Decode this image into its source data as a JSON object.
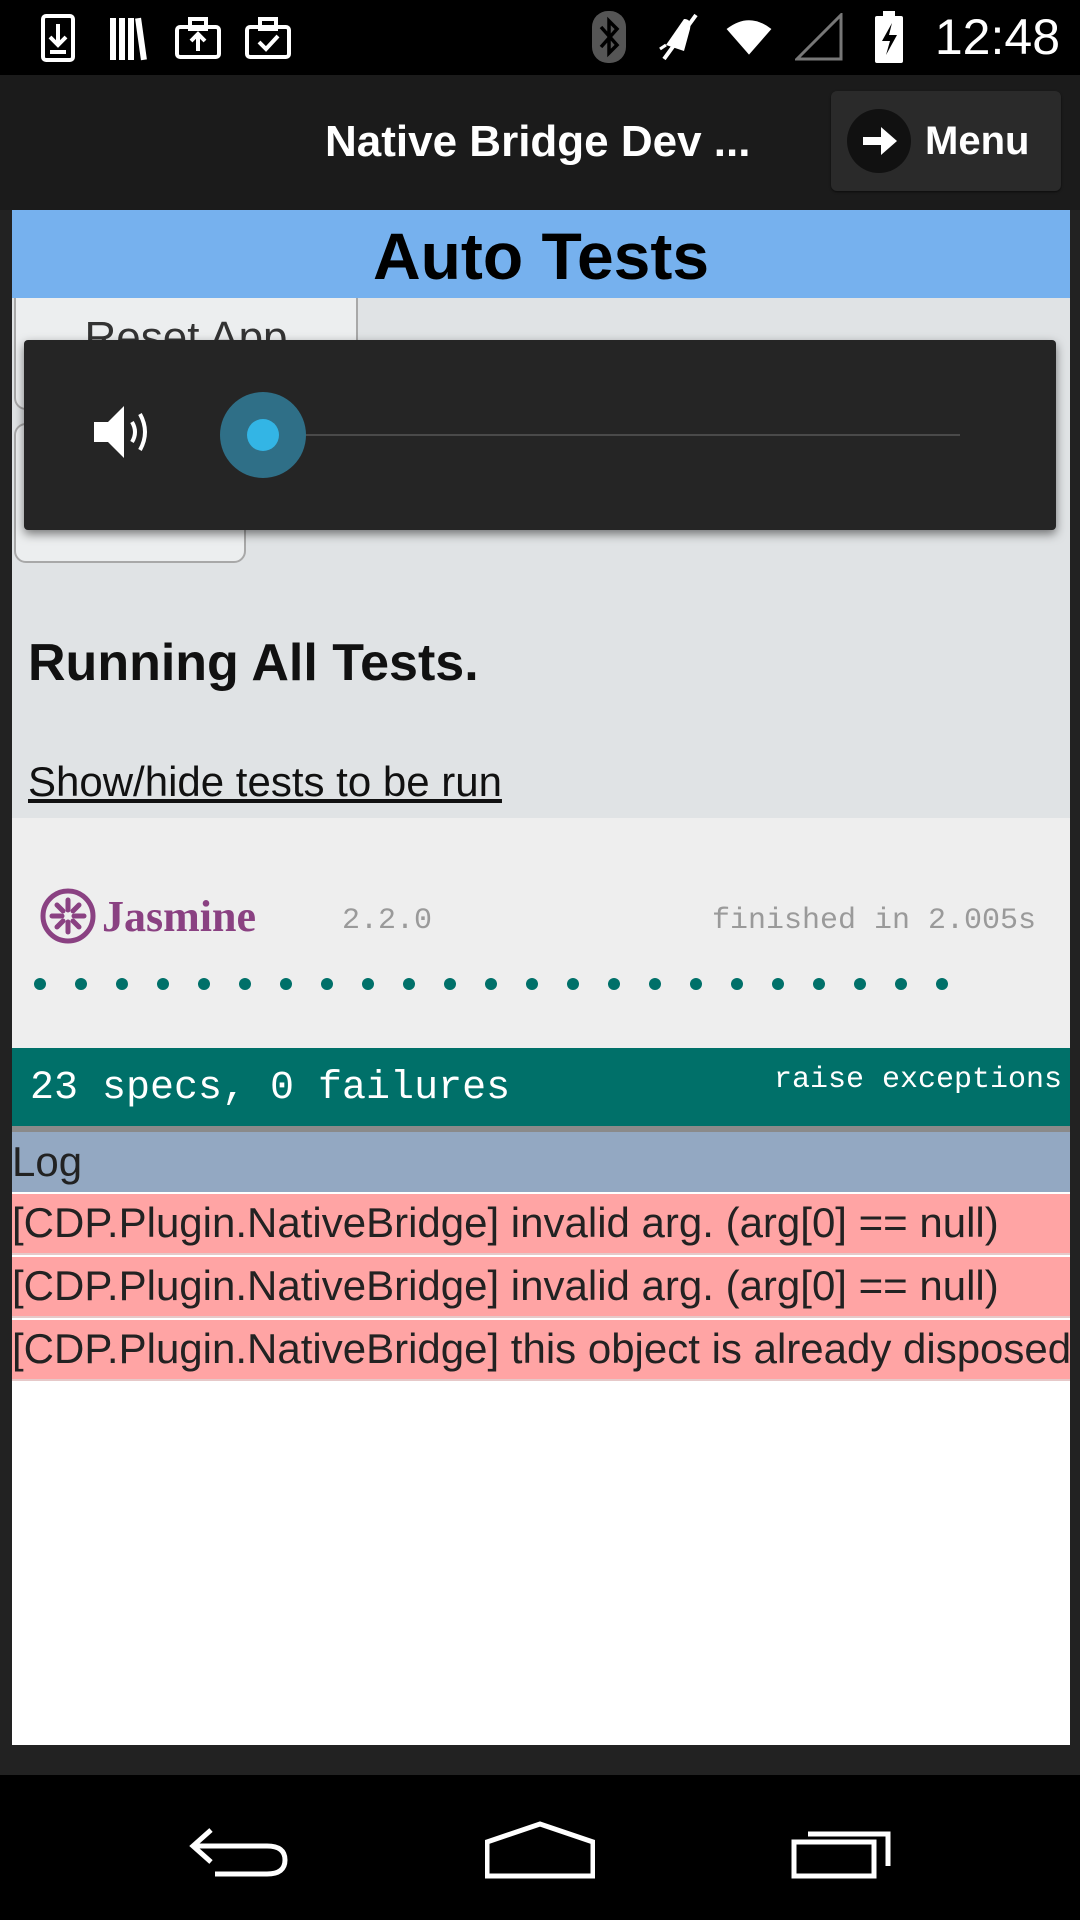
{
  "status_bar": {
    "time": "12:48",
    "left_icons": [
      "download-icon",
      "library-icon",
      "briefcase-upload-icon",
      "briefcase-check-icon"
    ],
    "right_icons": [
      "bluetooth-icon",
      "vibrate-off-icon",
      "wifi-icon",
      "signal-icon",
      "battery-icon"
    ]
  },
  "action_bar": {
    "title": "Native Bridge Dev ...",
    "menu_label": "Menu"
  },
  "page": {
    "header_title": "Auto Tests",
    "reset_button_label": "Reset App",
    "running_text": "Running All Tests.",
    "show_hide_link": "Show/hide tests to be run"
  },
  "jasmine": {
    "logo_text": "Jasmine",
    "version": "2.2.0",
    "finished": "finished in 2.005s",
    "passed_spec_dots": 23,
    "summary": "23 specs, 0 failures",
    "raise_exceptions": "raise exceptions"
  },
  "log": {
    "header": "Log",
    "entries": [
      "[CDP.Plugin.NativeBridge] invalid arg. (arg[0] == null)",
      "[CDP.Plugin.NativeBridge] invalid arg. (arg[0] == null)",
      "[CDP.Plugin.NativeBridge] this object is already disposed."
    ]
  },
  "volume_overlay": {
    "icon": "speaker-icon",
    "level": 0
  },
  "nav_bar": {
    "icons": [
      "back-icon",
      "home-icon",
      "recent-apps-icon"
    ]
  },
  "colors": {
    "header_blue": "#76b1ee",
    "jasmine_green": "#007069",
    "log_error": "#ffa4a4",
    "log_header": "#93a8c2"
  }
}
